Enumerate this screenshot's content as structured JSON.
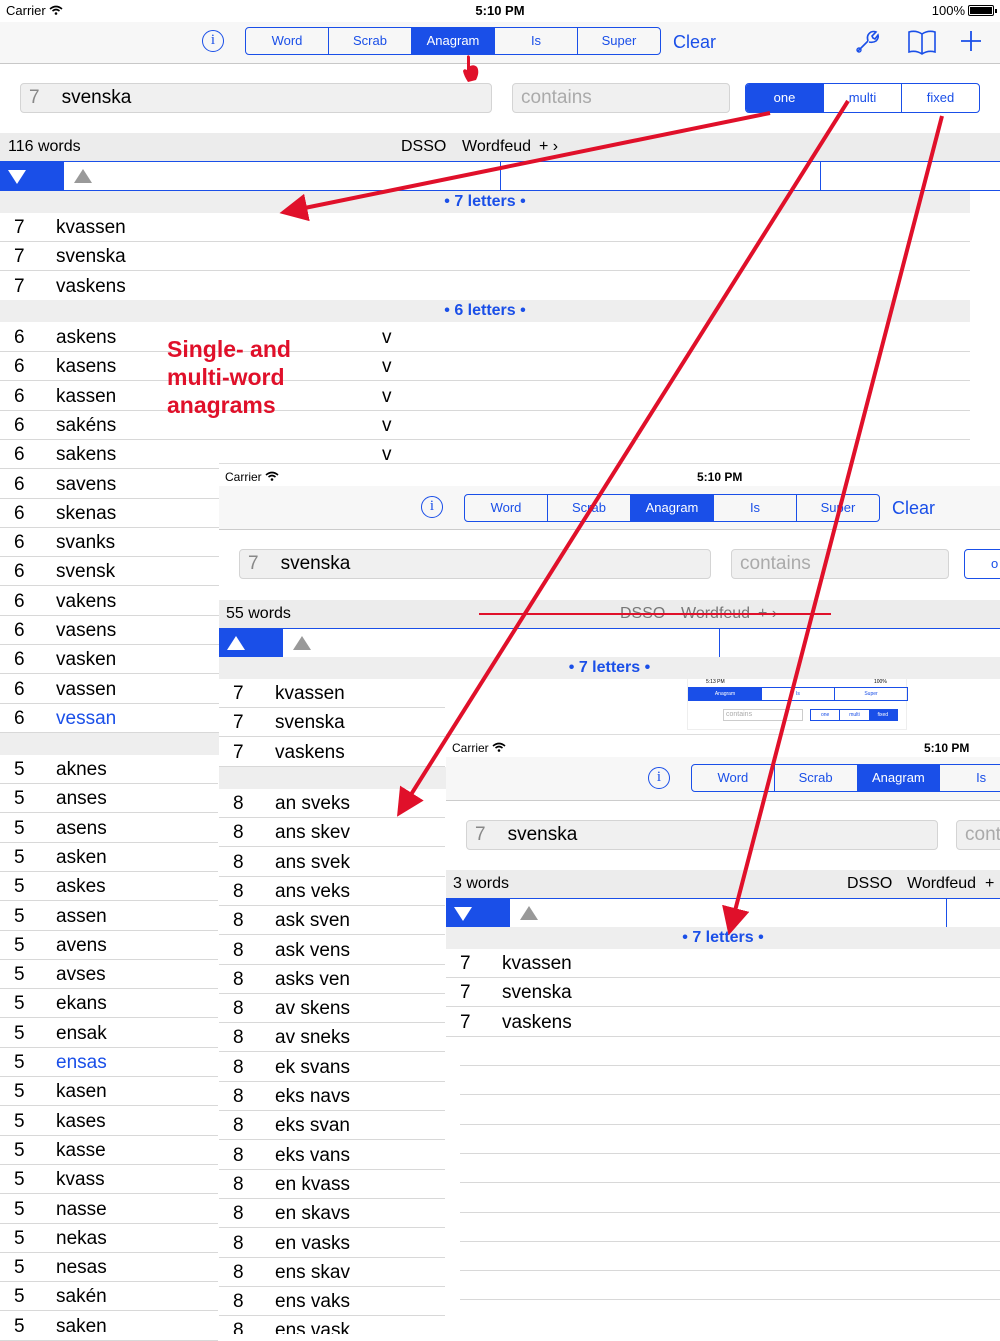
{
  "status": {
    "carrier": "Carrier",
    "time": "5:10 PM",
    "battery": "100%"
  },
  "main": {
    "tabs": [
      "Word",
      "Scrab",
      "Anagram",
      "Is",
      "Super"
    ],
    "active_tab": "Anagram",
    "clear": "Clear",
    "search": {
      "count": "7",
      "value": "svenska"
    },
    "filter_placeholder": "contains",
    "modes": [
      "one",
      "multi",
      "fixed"
    ],
    "active_mode": "one",
    "word_count": "116 words",
    "dict1": "DSSO",
    "dict2": "Wordfeud",
    "more": "+",
    "sections": [
      "• 7 letters •",
      "• 6 letters •"
    ],
    "rows7": [
      {
        "n": "7",
        "w": "kvassen"
      },
      {
        "n": "7",
        "w": "svenska"
      },
      {
        "n": "7",
        "w": "vaskens"
      }
    ],
    "rows6": [
      {
        "n": "6",
        "w": "askens",
        "f": "v"
      },
      {
        "n": "6",
        "w": "kasens",
        "f": "v"
      },
      {
        "n": "6",
        "w": "kassen",
        "f": "v"
      },
      {
        "n": "6",
        "w": "sakéns",
        "f": "v"
      },
      {
        "n": "6",
        "w": "sakens",
        "f": "v"
      },
      {
        "n": "6",
        "w": "savens"
      },
      {
        "n": "6",
        "w": "skenas"
      },
      {
        "n": "6",
        "w": "svanks"
      },
      {
        "n": "6",
        "w": "svensk"
      },
      {
        "n": "6",
        "w": "vakens"
      },
      {
        "n": "6",
        "w": "vasens"
      },
      {
        "n": "6",
        "w": "vasken"
      },
      {
        "n": "6",
        "w": "vassen"
      },
      {
        "n": "6",
        "w": "vessan",
        "blue": true
      }
    ],
    "rows5": [
      {
        "n": "5",
        "w": "aknes"
      },
      {
        "n": "5",
        "w": "anses"
      },
      {
        "n": "5",
        "w": "asens"
      },
      {
        "n": "5",
        "w": "asken"
      },
      {
        "n": "5",
        "w": "askes"
      },
      {
        "n": "5",
        "w": "assen"
      },
      {
        "n": "5",
        "w": "avens"
      },
      {
        "n": "5",
        "w": "avses"
      },
      {
        "n": "5",
        "w": "ekans"
      },
      {
        "n": "5",
        "w": "ensak"
      },
      {
        "n": "5",
        "w": "ensas",
        "blue": true
      },
      {
        "n": "5",
        "w": "kasen"
      },
      {
        "n": "5",
        "w": "kases"
      },
      {
        "n": "5",
        "w": "kasse"
      },
      {
        "n": "5",
        "w": "kvass"
      },
      {
        "n": "5",
        "w": "nasse"
      },
      {
        "n": "5",
        "w": "nekas"
      },
      {
        "n": "5",
        "w": "nesas"
      },
      {
        "n": "5",
        "w": "sakén"
      },
      {
        "n": "5",
        "w": "saken"
      }
    ]
  },
  "annotation": "Single- and multi-word anagrams",
  "second": {
    "carrier": "Carrier",
    "time": "5:10 PM",
    "tabs": [
      "Word",
      "Scrab",
      "Anagram",
      "Is",
      "Super"
    ],
    "clear": "Clear",
    "search": {
      "count": "7",
      "value": "svenska"
    },
    "filter_placeholder": "contains",
    "mode_partial": "o",
    "word_count": "55 words",
    "dict1": "DSSO",
    "dict2": "Wordfeud",
    "more": "+",
    "section": "• 7 letters •",
    "rows7": [
      {
        "n": "7",
        "w": "kvassen"
      },
      {
        "n": "7",
        "w": "svenska"
      },
      {
        "n": "7",
        "w": "vaskens"
      }
    ],
    "rows8": [
      {
        "n": "8",
        "w": "an sveks"
      },
      {
        "n": "8",
        "w": "ans skev"
      },
      {
        "n": "8",
        "w": "ans svek"
      },
      {
        "n": "8",
        "w": "ans veks"
      },
      {
        "n": "8",
        "w": "ask sven"
      },
      {
        "n": "8",
        "w": "ask vens"
      },
      {
        "n": "8",
        "w": "asks ven"
      },
      {
        "n": "8",
        "w": "av skens"
      },
      {
        "n": "8",
        "w": "av sneks"
      },
      {
        "n": "8",
        "w": "ek svans"
      },
      {
        "n": "8",
        "w": "eks navs"
      },
      {
        "n": "8",
        "w": "eks svan"
      },
      {
        "n": "8",
        "w": "eks vans"
      },
      {
        "n": "8",
        "w": "en kvass"
      },
      {
        "n": "8",
        "w": "en skavs"
      },
      {
        "n": "8",
        "w": "en vasks"
      },
      {
        "n": "8",
        "w": "ens skav"
      },
      {
        "n": "8",
        "w": "ens vaks"
      },
      {
        "n": "8",
        "w": "ens vask"
      }
    ]
  },
  "mini": {
    "time": "5:13 PM",
    "battery": "100%",
    "tabs": [
      "Anagram",
      "Is",
      "Super"
    ],
    "filter_placeholder": "contains",
    "modes": [
      "one",
      "multi",
      "fixed"
    ]
  },
  "third": {
    "carrier": "Carrier",
    "time": "5:10 PM",
    "tabs": [
      "Word",
      "Scrab",
      "Anagram",
      "Is"
    ],
    "search": {
      "count": "7",
      "value": "svenska"
    },
    "filter_placeholder": "cont",
    "word_count": "3 words",
    "dict1": "DSSO",
    "dict2": "Wordfeud",
    "more": "+",
    "section": "• 7 letters •",
    "rows7": [
      {
        "n": "7",
        "w": "kvassen"
      },
      {
        "n": "7",
        "w": "svenska"
      },
      {
        "n": "7",
        "w": "vaskens"
      }
    ]
  },
  "colors": {
    "accent": "#1a4fe8",
    "annotation": "#e0102a"
  }
}
